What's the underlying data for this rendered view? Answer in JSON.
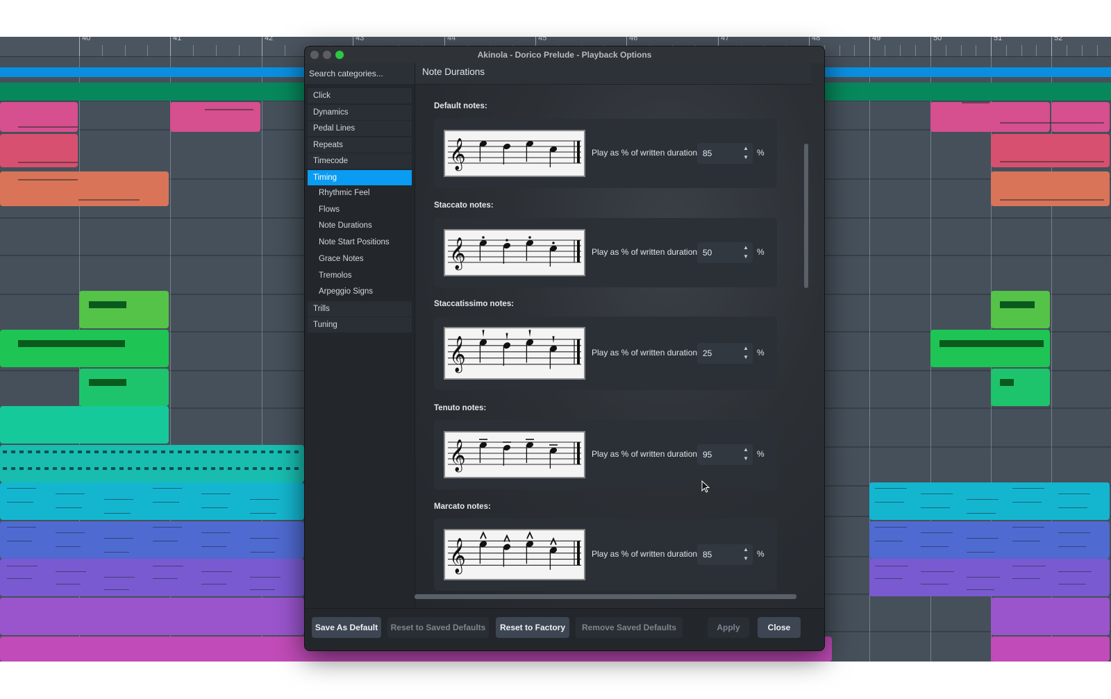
{
  "window": {
    "title": "Akinola - Dorico Prelude - Playback Options"
  },
  "background": {
    "ruler_bars": [
      "40",
      "41",
      "42",
      "43",
      "44",
      "45",
      "46",
      "47",
      "48",
      "49",
      "50",
      "51",
      "52"
    ]
  },
  "sidebar": {
    "search_placeholder": "Search categories...",
    "categories": [
      {
        "label": "Click"
      },
      {
        "label": "Dynamics"
      },
      {
        "label": "Pedal Lines"
      },
      {
        "label": "Repeats"
      },
      {
        "label": "Timecode"
      },
      {
        "label": "Timing",
        "active": true
      }
    ],
    "timing_sub": [
      {
        "label": "Rhythmic Feel"
      },
      {
        "label": "Flows"
      },
      {
        "label": "Note Durations"
      },
      {
        "label": "Note Start Positions"
      },
      {
        "label": "Grace Notes"
      },
      {
        "label": "Tremolos"
      },
      {
        "label": "Arpeggio Signs"
      }
    ],
    "after": [
      {
        "label": "Trills"
      },
      {
        "label": "Tuning"
      }
    ]
  },
  "content": {
    "title": "Note Durations",
    "duration_label": "Play as % of written duration:",
    "percent": "%",
    "sections": [
      {
        "label": "Default notes:",
        "value": "85",
        "articulation": "none"
      },
      {
        "label": "Staccato notes:",
        "value": "50",
        "articulation": "staccato"
      },
      {
        "label": "Staccatissimo notes:",
        "value": "25",
        "articulation": "staccatissimo"
      },
      {
        "label": "Tenuto notes:",
        "value": "95",
        "articulation": "tenuto"
      },
      {
        "label": "Marcato notes:",
        "value": "85",
        "articulation": "marcato"
      }
    ]
  },
  "footer": {
    "save_default": "Save As Default",
    "reset_saved": "Reset to Saved Defaults",
    "reset_factory": "Reset to Factory",
    "remove_saved": "Remove Saved Defaults",
    "apply": "Apply",
    "close": "Close"
  },
  "colors": {
    "accent": "#0a9bf2"
  }
}
